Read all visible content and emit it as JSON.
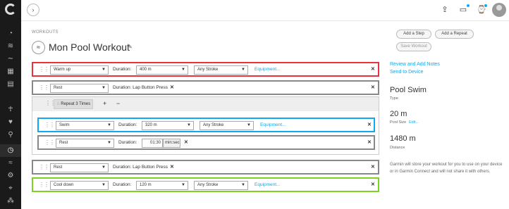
{
  "topbar": {
    "expand_icon": "chevron-right"
  },
  "breadcrumb": "WORKOUTS",
  "workout": {
    "name": "Mon Pool Workout"
  },
  "actions": {
    "add_step": "Add a Step",
    "add_repeat": "Add a Repeat",
    "save": "Save Workout"
  },
  "steps": {
    "warmup": {
      "type": "Warm up",
      "duration_label": "Duration:",
      "distance": "400 m",
      "stroke": "Any Stroke",
      "equipment": "Equipment..."
    },
    "rest1": {
      "type": "Rest",
      "duration_label": "Duration: Lap Button Press"
    },
    "repeat": {
      "label": "Repeat 3 Times",
      "plus": "+",
      "minus": "−"
    },
    "swim": {
      "type": "Swim",
      "duration_label": "Duration:",
      "distance": "320 m",
      "stroke": "Any Stroke",
      "equipment": "Equipment..."
    },
    "rest2": {
      "type": "Rest",
      "duration_label": "Duration:",
      "time": "01:30",
      "unit": "min:sec"
    },
    "rest3": {
      "type": "Rest",
      "duration_label": "Duration: Lap Button Press"
    },
    "cooldown": {
      "type": "Cool down",
      "duration_label": "Duration:",
      "distance": "120 m",
      "stroke": "Any Stroke",
      "equipment": "Equipment..."
    }
  },
  "right_panel": {
    "review_link": "Review and Add Notes",
    "send_link": "Send to Device",
    "type_value": "Pool Swim",
    "type_label": "Type",
    "pool_value": "20 m",
    "pool_label": "Pool Size",
    "pool_edit": "Edit...",
    "distance_value": "1480 m",
    "distance_label": "Distance",
    "note": "Garmin will store your workout for you to use on your device or in Garmin Connect and will not share it with others."
  },
  "colors": {
    "warmup": "#e8323c",
    "rest": "#888888",
    "swim": "#11a9ed",
    "cooldown": "#7ed321"
  }
}
